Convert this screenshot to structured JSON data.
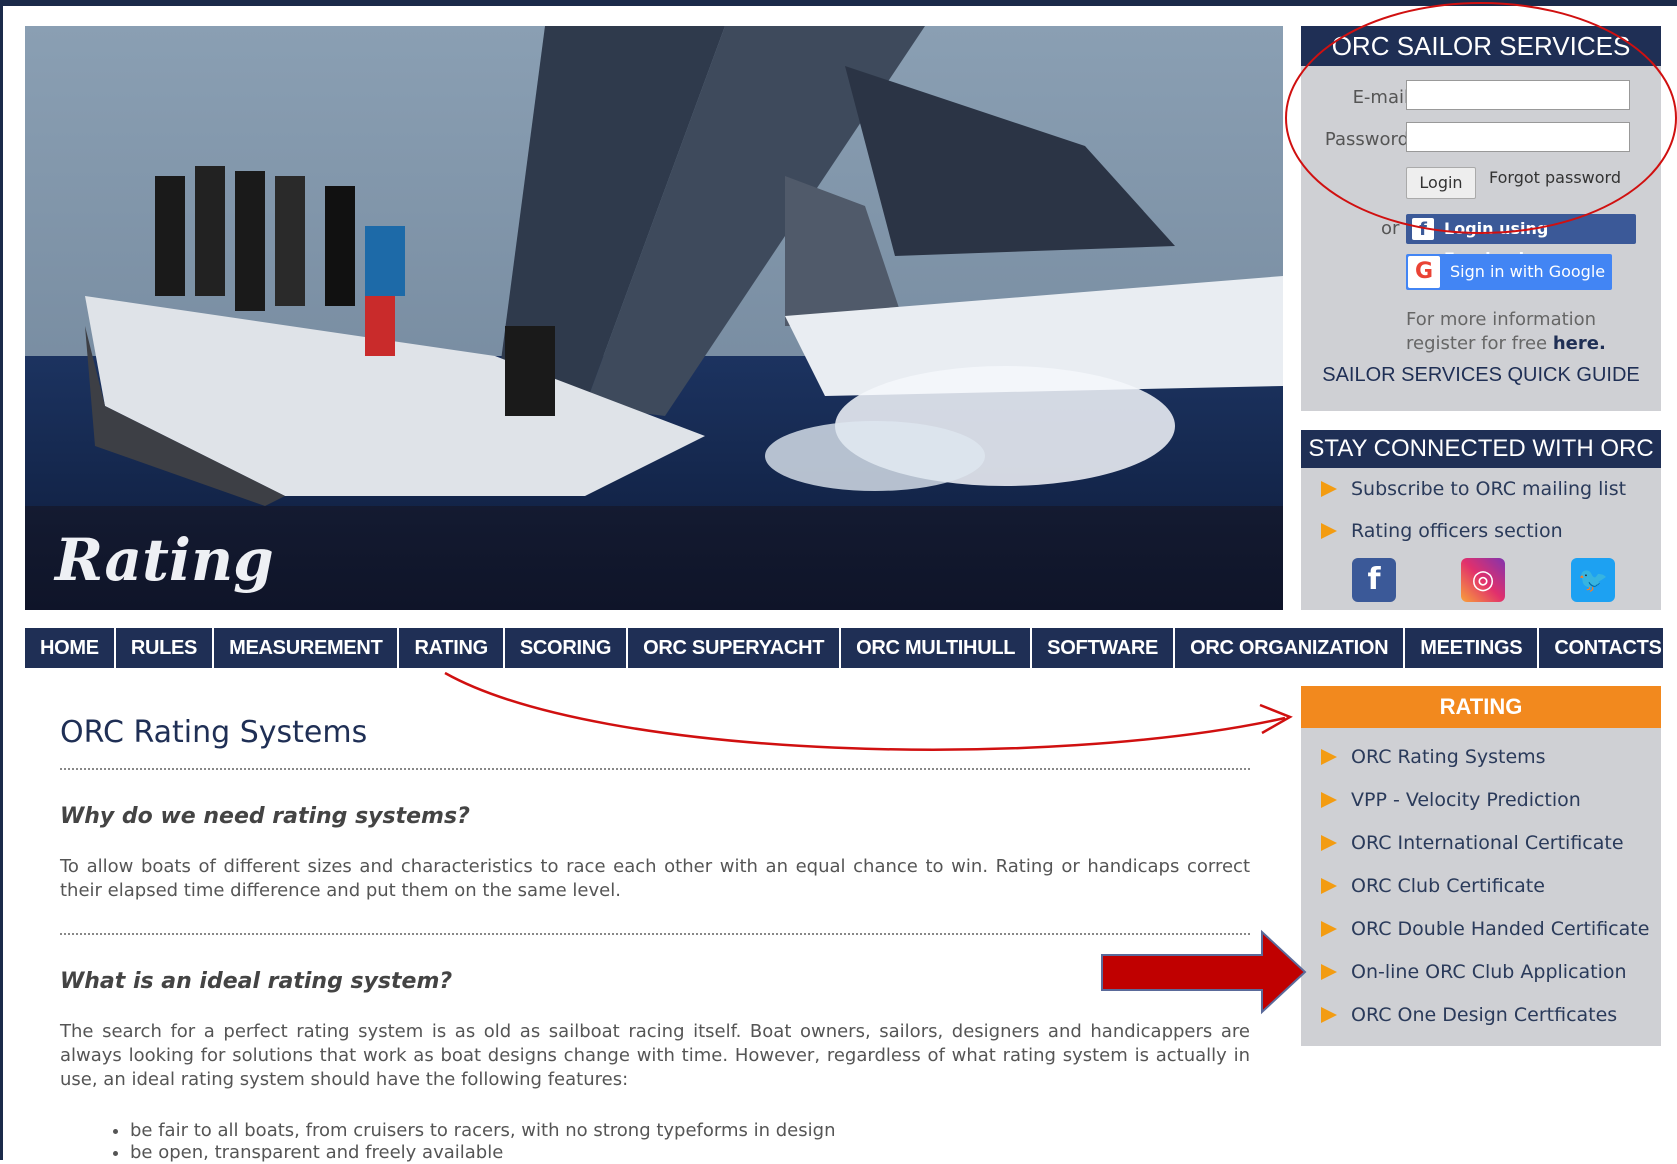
{
  "hero": {
    "title": "Rating"
  },
  "sailor_services": {
    "title": "ORC SAILOR SERVICES",
    "email_label": "E-mail",
    "password_label": "Password",
    "email_value": "",
    "password_value": "",
    "login_label": "Login",
    "forgot_label": "Forgot password",
    "or_label": "or",
    "facebook_label": "Login using Facebook",
    "google_label": "Sign in with Google",
    "more_info_text": "For more information register for free",
    "more_info_link": "here.",
    "quick_guide": "SAILOR SERVICES QUICK GUIDE"
  },
  "stay_connected": {
    "title": "STAY CONNECTED WITH ORC",
    "items": [
      "Subscribe to ORC mailing list",
      "Rating officers section"
    ],
    "social": [
      "facebook-icon",
      "instagram-icon",
      "twitter-icon"
    ]
  },
  "nav": {
    "items": [
      "HOME",
      "RULES",
      "MEASUREMENT",
      "RATING",
      "SCORING",
      "ORC SUPERYACHT",
      "ORC MULTIHULL",
      "SOFTWARE",
      "ORC ORGANIZATION",
      "MEETINGS",
      "CONTACTS"
    ]
  },
  "rating_menu": {
    "title": "RATING",
    "items": [
      "ORC Rating Systems",
      "VPP - Velocity Prediction",
      "ORC International Certificate",
      "ORC Club Certificate",
      "ORC Double Handed Certificate",
      "On-line ORC Club Application",
      "ORC One Design Certficates"
    ]
  },
  "content": {
    "title": "ORC Rating Systems",
    "q1": "Why do we need rating systems?",
    "a1": "To allow boats of different sizes and characteristics to race each other with an equal chance to win. Rating or handicaps correct their elapsed time difference and put them on the same level.",
    "q2": "What is an ideal rating system?",
    "a2": "The search for a perfect rating system is as old as sailboat racing itself. Boat owners, sailors, designers and handicappers are always looking for solutions that work as boat designs change with time. However, regardless of what rating system is actually in use, an ideal rating system should have the following features:",
    "features": [
      "be fair to all boats, from cruisers to racers, with no strong typeforms in design",
      "be open, transparent and freely available"
    ]
  },
  "colors": {
    "navy": "#1f2f55",
    "orange": "#f2891e",
    "panel_gray": "#cfd0d4",
    "annotation_red": "#d01010"
  }
}
